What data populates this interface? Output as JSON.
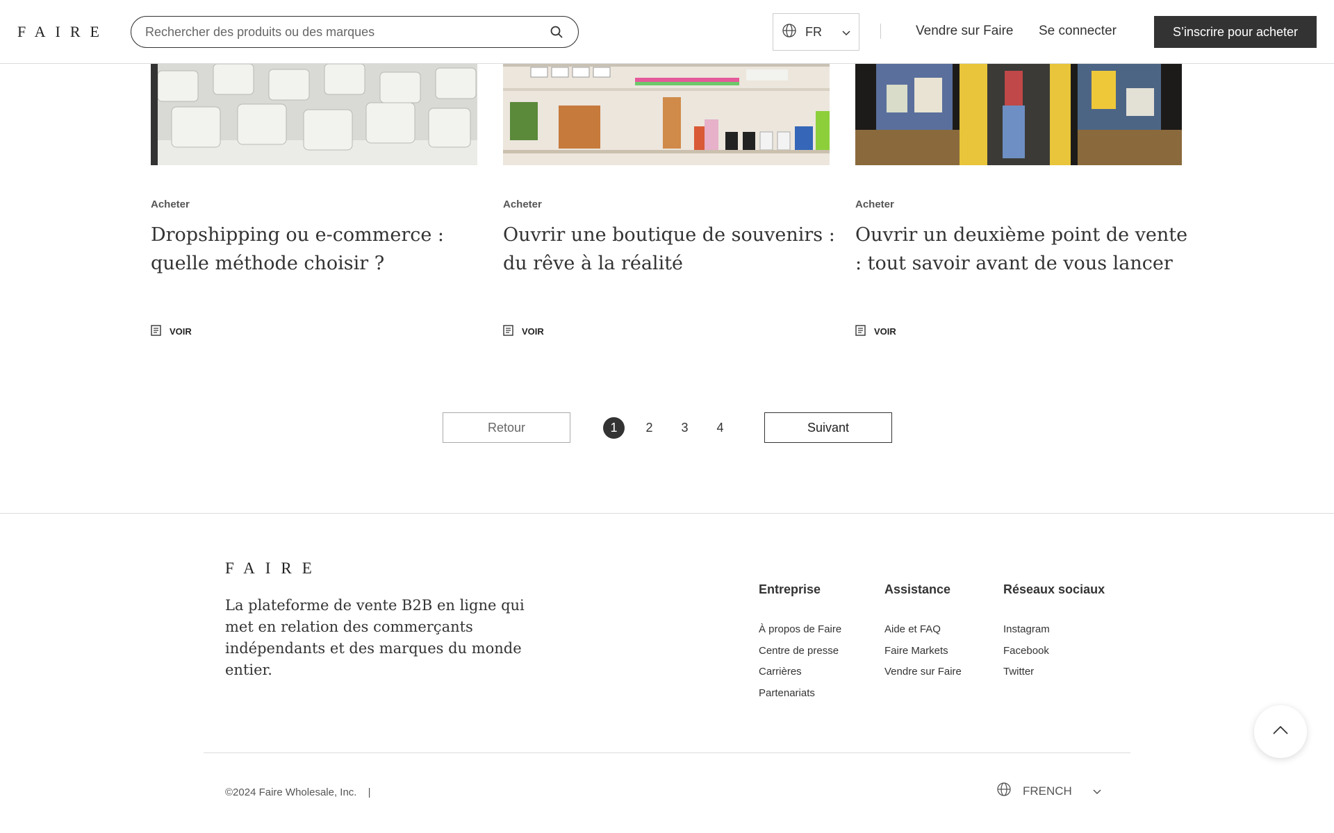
{
  "header": {
    "logo": "FAIRE",
    "search_placeholder": "Rechercher des produits ou des marques",
    "language": "FR",
    "sell_link": "Vendre sur Faire",
    "login_link": "Se connecter",
    "signup_button": "S’inscrire pour acheter"
  },
  "articles": [
    {
      "category": "Acheter",
      "title": "Dropshipping ou e-commerce : quelle méthode choisir ?",
      "action": "VOIR"
    },
    {
      "category": "Acheter",
      "title": "Ouvrir une boutique de souvenirs : du rêve à la réalité",
      "action": "VOIR"
    },
    {
      "category": "Acheter",
      "title": "Ouvrir un deuxième point de vente : tout savoir avant de vous lancer",
      "action": "VOIR"
    }
  ],
  "pagination": {
    "prev_label": "Retour",
    "next_label": "Suivant",
    "pages": [
      "1",
      "2",
      "3",
      "4"
    ],
    "current": "1"
  },
  "footer": {
    "logo": "FAIRE",
    "tagline": "La plateforme de vente B2B en ligne qui met en relation des commerçants indépendants et des marques du monde entier.",
    "columns": [
      {
        "heading": "Entreprise",
        "links": [
          "À propos de Faire",
          "Centre de presse",
          "Carrières",
          "Partenariats"
        ]
      },
      {
        "heading": "Assistance",
        "links": [
          "Aide et FAQ",
          "Faire Markets",
          "Vendre sur Faire"
        ]
      },
      {
        "heading": "Réseaux sociaux",
        "links": [
          "Instagram",
          "Facebook",
          "Twitter"
        ]
      }
    ],
    "copyright": "©2024 Faire Wholesale, Inc.",
    "separator": "|",
    "language": "FRENCH"
  }
}
